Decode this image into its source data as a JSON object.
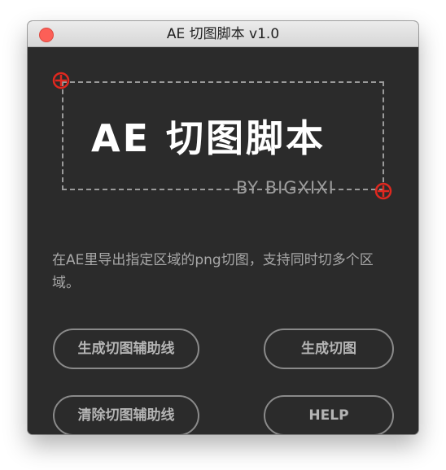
{
  "window": {
    "title": "AE 切图脚本 v1.0"
  },
  "banner": {
    "logo_title": "AE 切图脚本",
    "logo_byline": "BY BIGXIXI",
    "marker_color": "#e0281f"
  },
  "description": "在AE里导出指定区域的png切图，支持同时切多个区域。",
  "buttons": {
    "generate_guides": "生成切图辅助线",
    "generate_slices": "生成切图",
    "clear_guides": "清除切图辅助线",
    "help": "HELP"
  },
  "colors": {
    "panel_background": "#2b2b2b",
    "close_button": "#fc5f57",
    "button_border": "#8a8a8a",
    "button_text": "#b5b5b5",
    "body_text": "#a8a8a8"
  }
}
